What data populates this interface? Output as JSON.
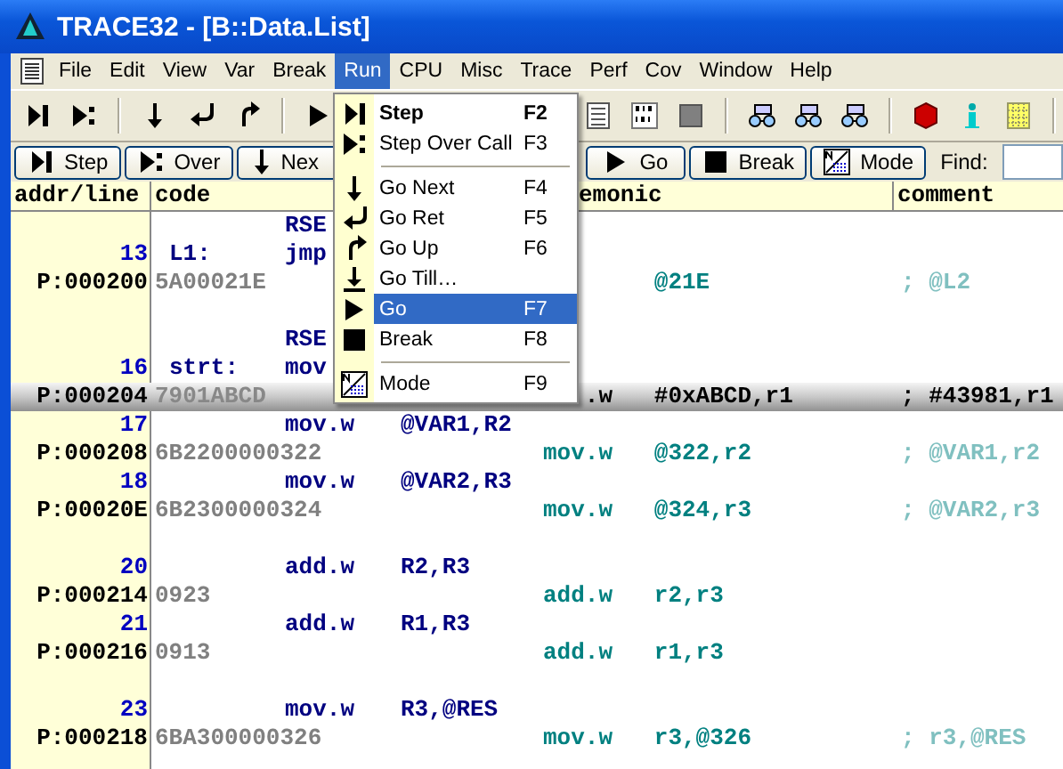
{
  "window": {
    "title": "TRACE32 - [B::Data.List]"
  },
  "menu_bar": [
    {
      "label": "File",
      "selected": false
    },
    {
      "label": "Edit",
      "selected": false
    },
    {
      "label": "View",
      "selected": false
    },
    {
      "label": "Var",
      "selected": false
    },
    {
      "label": "Break",
      "selected": false
    },
    {
      "label": "Run",
      "selected": true
    },
    {
      "label": "CPU",
      "selected": false
    },
    {
      "label": "Misc",
      "selected": false
    },
    {
      "label": "Trace",
      "selected": false
    },
    {
      "label": "Perf",
      "selected": false
    },
    {
      "label": "Cov",
      "selected": false
    },
    {
      "label": "Window",
      "selected": false
    },
    {
      "label": "Help",
      "selected": false
    }
  ],
  "buttons_left": [
    "Step",
    "Over",
    "Nex"
  ],
  "buttons_right": [
    "Go",
    "Break",
    "Mode"
  ],
  "find": {
    "label": "Find:"
  },
  "columns": [
    "addr/line",
    "code",
    "emonic",
    "comment"
  ],
  "rows": [
    {
      "kind": "source",
      "mnemonic": "RSE"
    },
    {
      "kind": "source",
      "line": "13",
      "label": "L1:",
      "mnemonic": "jmp"
    },
    {
      "kind": "asm",
      "addr": "P:000200",
      "code": "5A00021E",
      "operands": "@21E",
      "comment": "; @L2",
      "selected": false
    },
    {
      "kind": "gap"
    },
    {
      "kind": "source",
      "mnemonic": "RSE"
    },
    {
      "kind": "source",
      "line": "16",
      "label": "strt:",
      "mnemonic": "mov"
    },
    {
      "kind": "asm",
      "addr": "P:000204",
      "code": "7901ABCD",
      "mnemonic": ".w",
      "operands": "#0xABCD,r1",
      "comment": "; #43981,r1",
      "selected": true
    },
    {
      "kind": "source",
      "line": "17",
      "mnemonic": "mov.w",
      "operands": "@VAR1,R2"
    },
    {
      "kind": "asm",
      "addr": "P:000208",
      "code": "6B2200000322",
      "mnemonic": "mov.w",
      "operands": "@322,r2",
      "comment": "; @VAR1,r2",
      "selected": false
    },
    {
      "kind": "source",
      "line": "18",
      "mnemonic": "mov.w",
      "operands": "@VAR2,R3"
    },
    {
      "kind": "asm",
      "addr": "P:00020E",
      "code": "6B2300000324",
      "mnemonic": "mov.w",
      "operands": "@324,r3",
      "comment": "; @VAR2,r3",
      "selected": false
    },
    {
      "kind": "gap"
    },
    {
      "kind": "source",
      "line": "20",
      "mnemonic": "add.w",
      "operands": "R2,R3"
    },
    {
      "kind": "asm",
      "addr": "P:000214",
      "code": "0923",
      "mnemonic": "add.w",
      "operands": "r2,r3",
      "selected": false
    },
    {
      "kind": "source",
      "line": "21",
      "mnemonic": "add.w",
      "operands": "R1,R3"
    },
    {
      "kind": "asm",
      "addr": "P:000216",
      "code": "0913",
      "mnemonic": "add.w",
      "operands": "r1,r3",
      "selected": false
    },
    {
      "kind": "gap"
    },
    {
      "kind": "source",
      "line": "23",
      "mnemonic": "mov.w",
      "operands": "R3,@RES"
    },
    {
      "kind": "asm",
      "addr": "P:000218",
      "code": "6BA300000326",
      "mnemonic": "mov.w",
      "operands": "r3,@326",
      "comment": "; r3,@RES",
      "selected": false
    }
  ],
  "run_menu": [
    {
      "kind": "item",
      "label": "Step",
      "shortcut": "F2",
      "bold": true,
      "selected": false
    },
    {
      "kind": "item",
      "label": "Step Over Call",
      "shortcut": "F3",
      "bold": false,
      "selected": false
    },
    {
      "kind": "separator"
    },
    {
      "kind": "item",
      "label": "Go Next",
      "shortcut": "F4",
      "bold": false,
      "selected": false
    },
    {
      "kind": "item",
      "label": "Go Ret",
      "shortcut": "F5",
      "bold": false,
      "selected": false
    },
    {
      "kind": "item",
      "label": "Go Up",
      "shortcut": "F6",
      "bold": false,
      "selected": false
    },
    {
      "kind": "item",
      "label": "Go Till…",
      "bold": false,
      "selected": false
    },
    {
      "kind": "item",
      "label": "Go",
      "shortcut": "F7",
      "bold": false,
      "selected": true
    },
    {
      "kind": "item",
      "label": "Break",
      "shortcut": "F8",
      "bold": false,
      "selected": false
    },
    {
      "kind": "separator"
    },
    {
      "kind": "item",
      "label": "Mode",
      "shortcut": "F9",
      "bold": false,
      "selected": false
    }
  ]
}
